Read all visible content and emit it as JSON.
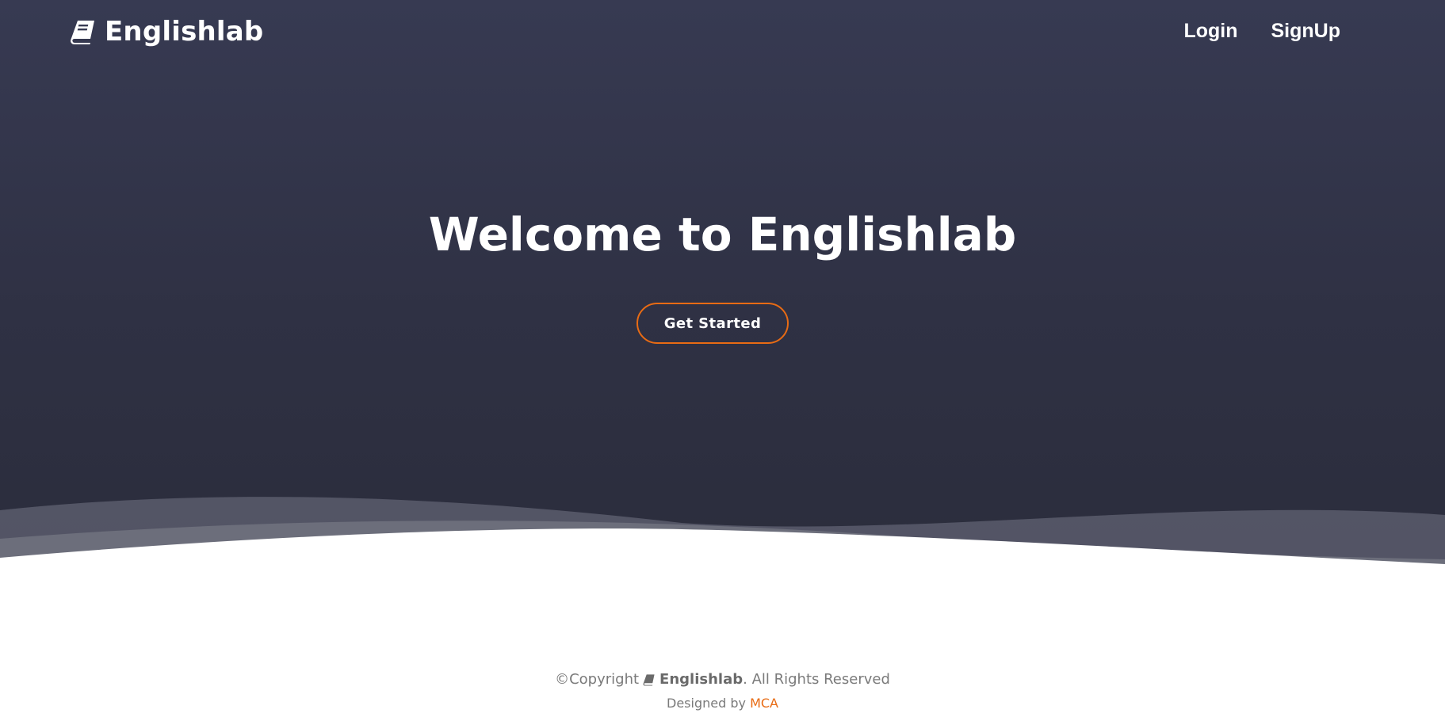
{
  "navbar": {
    "brand": "Englishlab",
    "brand_icon": "book-icon",
    "links": [
      {
        "label": "Login"
      },
      {
        "label": "SignUp"
      }
    ]
  },
  "hero": {
    "title": "Welcome to Englishlab",
    "cta_label": "Get Started"
  },
  "footer": {
    "copyright_prefix": "©Copyright",
    "copyright_brand": "Englishlab",
    "copyright_suffix": ". All Rights Reserved",
    "designed_prefix": "Designed by ",
    "designed_link": "MCA"
  },
  "colors": {
    "hero_bg": "#2f3144",
    "accent": "#e86b14",
    "footer_text": "#7a7a7a"
  }
}
